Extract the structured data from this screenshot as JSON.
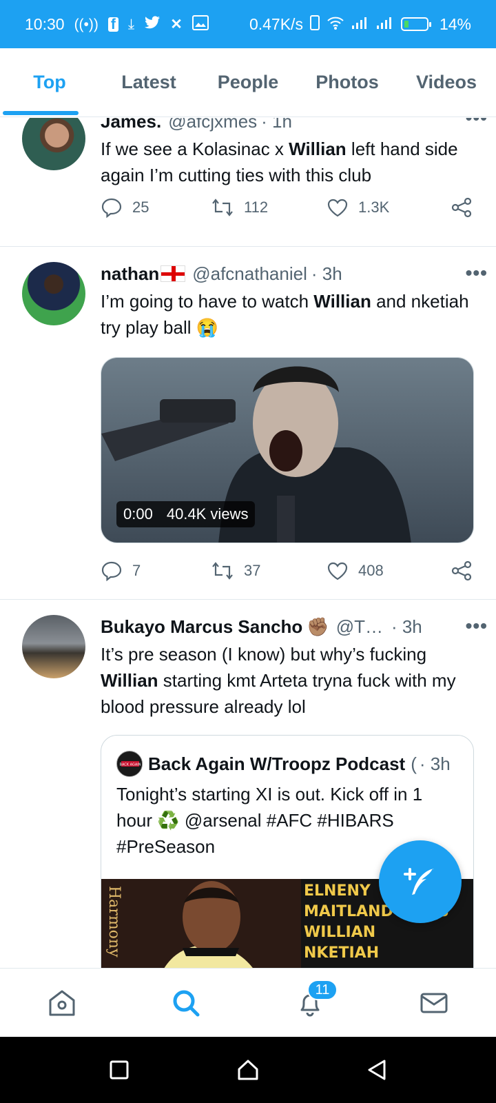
{
  "status_bar": {
    "time": "10:30",
    "speed": "0.47K/s",
    "battery": "14%",
    "battery_level_pct": 14
  },
  "tabs": [
    {
      "label": "Top",
      "active": true
    },
    {
      "label": "Latest",
      "active": false
    },
    {
      "label": "People",
      "active": false
    },
    {
      "label": "Photos",
      "active": false
    },
    {
      "label": "Videos",
      "active": false
    }
  ],
  "tweets": [
    {
      "name": "James.",
      "handle": "@afcjxmes",
      "time": "· 1h",
      "text_before": "If we see a Kolasinac x ",
      "highlight": "Willian",
      "text_after": " left hand side again I’m cutting ties with this club",
      "replies": "25",
      "retweets": "112",
      "likes": "1.3K"
    },
    {
      "name": "nathan",
      "handle": "@afcnathaniel",
      "time": "· 3h",
      "text_before": "I’m going to have to watch ",
      "highlight": "Willian",
      "text_after": " and nketiah try play ball 😭",
      "media_time": "0:00",
      "media_views": "40.4K views",
      "replies": "7",
      "retweets": "37",
      "likes": "408"
    },
    {
      "name": "Bukayo Marcus Sancho",
      "name_emoji": "✊🏽",
      "handle": "@T…",
      "time": "· 3h",
      "text_before": "It’s pre season (I know) but why’s fucking ",
      "highlight": "Willian",
      "text_after": " starting kmt Arteta tryna fuck with my blood pressure already lol",
      "quote": {
        "name": "Back Again W/Troopz Podcast",
        "name_trail": "(",
        "time": "· 3h",
        "text": "Tonight’s starting XI is out. Kick off in 1 hour ♻️ @arsenal #AFC #HIBARS #PreSeason",
        "avatar_text": "BACK AGAIN",
        "image_lines": [
          "ELNENY",
          "MAITLAND-NILES",
          "WILLIAN",
          "NKETIAH"
        ],
        "image_side_text": "Harmony"
      }
    }
  ],
  "bottom_nav": {
    "notifications_count": "11"
  },
  "colors": {
    "accent": "#1da1f2",
    "text": "#0f1419",
    "secondary": "#536471"
  }
}
